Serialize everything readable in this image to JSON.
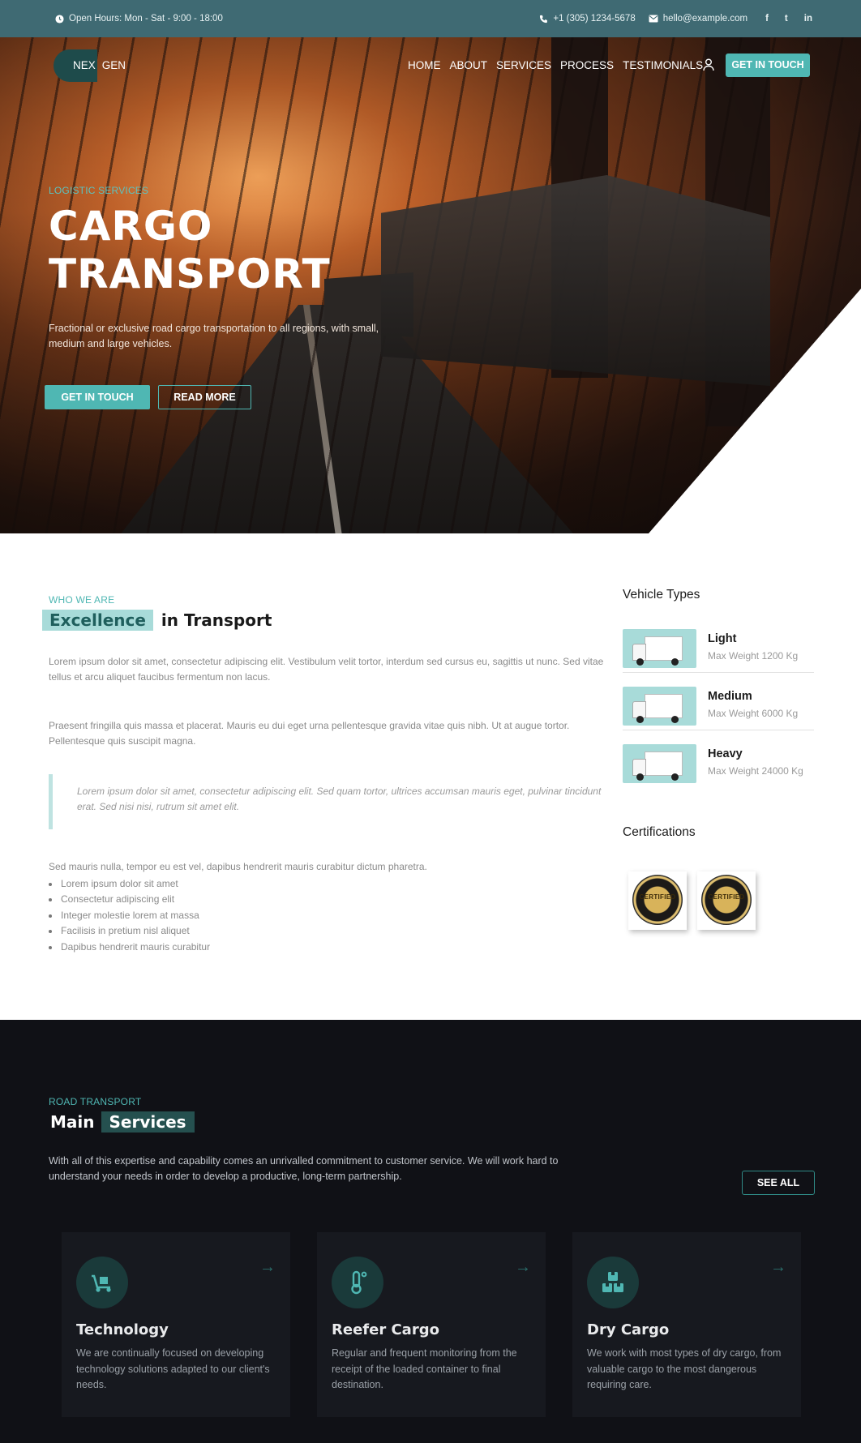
{
  "topbar": {
    "hours": "Open Hours: Mon - Sat - 9:00 - 18:00",
    "phone": "+1 (305) 1234-5678",
    "email": "hello@example.com",
    "social": [
      "f",
      "t",
      "in"
    ]
  },
  "nav": {
    "logo_part1": "NEX",
    "logo_part2": "GEN",
    "items": [
      "HOME",
      "ABOUT",
      "SERVICES",
      "PROCESS",
      "TESTIMONIALS"
    ],
    "cta": "GET IN TOUCH"
  },
  "hero": {
    "eyebrow": "LOGISTIC SERVICES",
    "title_line1": "CARGO",
    "title_line2": "TRANSPORT",
    "subtitle": "Fractional or exclusive road cargo transportation to all regions, with small, medium and large vehicles.",
    "btn_primary": "GET IN TOUCH",
    "btn_secondary": "READ MORE"
  },
  "about": {
    "eyebrow": "WHO WE ARE",
    "title_highlight": "Excellence",
    "title_rest": "in Transport",
    "para1": "Lorem ipsum dolor sit amet, consectetur adipiscing elit. Vestibulum velit tortor, interdum sed cursus eu, sagittis ut nunc. Sed vitae tellus et arcu aliquet faucibus fermentum non lacus.",
    "para2": "Praesent fringilla quis massa et placerat. Mauris eu dui eget urna pellentesque gravida vitae quis nibh. Ut at augue tortor. Pellentesque quis suscipit magna.",
    "quote": "Lorem ipsum dolor sit amet, consectetur adipiscing elit. Sed quam tortor, ultrices accumsan mauris eget, pulvinar tincidunt erat. Sed nisi nisi, rutrum sit amet elit.",
    "list_intro": "Sed mauris nulla, tempor eu est vel, dapibus hendrerit mauris curabitur dictum pharetra.",
    "list": [
      "Lorem ipsum dolor sit amet",
      "Consectetur adipiscing elit",
      "Integer molestie lorem at massa",
      "Facilisis in pretium nisl aliquet",
      "Dapibus hendrerit mauris curabitur"
    ]
  },
  "sidebar": {
    "vehicle_title": "Vehicle Types",
    "vehicles": [
      {
        "name": "Light",
        "weight": "Max Weight 1200 Kg"
      },
      {
        "name": "Medium",
        "weight": "Max Weight 6000 Kg"
      },
      {
        "name": "Heavy",
        "weight": "Max Weight 24000 Kg"
      }
    ],
    "cert_title": "Certifications",
    "cert_labels": [
      "CERTIFIED",
      "CERTIFIED"
    ]
  },
  "services": {
    "eyebrow": "ROAD TRANSPORT",
    "title_main": "Main",
    "title_highlight": "Services",
    "description": "With all of this expertise and capability comes an unrivalled commitment to customer service. We will work hard to understand your needs in order to develop a productive, long-term partnership.",
    "see_all": "SEE ALL",
    "cards": [
      {
        "title": "Technology",
        "text": "We are continually focused on developing technology solutions adapted to our client's needs.",
        "icon": "dolly-icon"
      },
      {
        "title": "Reefer Cargo",
        "text": "Regular and frequent monitoring from the receipt of the loaded container to final destination.",
        "icon": "thermometer-icon"
      },
      {
        "title": "Dry Cargo",
        "text": "We work with most types of dry cargo, from valuable cargo to the most dangerous requiring care.",
        "icon": "boxes-icon"
      }
    ]
  },
  "colors": {
    "accent": "#4fb7b3",
    "topbar": "#3f6a73",
    "dark": "#101116"
  }
}
